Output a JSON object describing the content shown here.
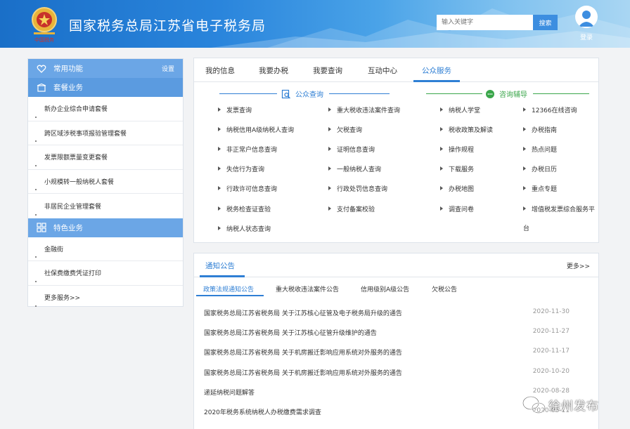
{
  "header": {
    "title": "国家税务总局江苏省电子税务局",
    "emblem_text": "中国税务",
    "search_placeholder": "输入关键字",
    "search_button": "搜索",
    "login_label": "登录"
  },
  "left_panel": {
    "common": {
      "label": "常用功能",
      "settings": "设置"
    },
    "package": {
      "label": "套餐业务",
      "items": [
        "新办企业综合申请套餐",
        "跨区域涉税事项报验管理套餐",
        "发票限额票量变更套餐",
        "小规模转一般纳税人套餐",
        "非居民企业管理套餐"
      ]
    },
    "special": {
      "label": "特色业务",
      "items": [
        "金融街",
        "社保费缴费凭证打印",
        "更多服务>>"
      ]
    }
  },
  "services": {
    "tabs": [
      "我的信息",
      "我要办税",
      "我要查询",
      "互动中心",
      "公众服务"
    ],
    "active_tab": "公众服务",
    "public_query": {
      "title": "公众查询",
      "col1": [
        "发票查询",
        "纳税信用A级纳税人查询",
        "非正常户信息查询",
        "失信行为查询",
        "行政许可信息查询",
        "税务检查证查验",
        "纳税人状态查询"
      ],
      "col2": [
        "重大税收违法案件查询",
        "欠税查询",
        "证明信息查询",
        "一般纳税人查询",
        "行政处罚信息查询",
        "支付备案校验"
      ]
    },
    "consult": {
      "title": "咨询辅导",
      "col1": [
        "纳税人学堂",
        "税收政策及解读",
        "操作规程",
        "下载服务",
        "办税地图",
        "调查问卷"
      ],
      "col2": [
        "12366在线咨询",
        "办税指南",
        "热点问题",
        "办税日历",
        "重点专题",
        "增值税发票综合服务平",
        "台"
      ]
    }
  },
  "notice": {
    "title": "通知公告",
    "more": "更多>>",
    "subtabs": [
      "政策法规通知公告",
      "重大税收违法案件公告",
      "信用级别A级公告",
      "欠税公告"
    ],
    "items": [
      {
        "title": "国家税务总局江苏省税务局 关于江苏核心征管及电子税务局升级的通告",
        "date": "2020-11-30"
      },
      {
        "title": "国家税务总局江苏省税务局 关于江苏核心征管升级维护的通告",
        "date": "2020-11-27"
      },
      {
        "title": "国家税务总局江苏省税务局 关于机房搬迁影响应用系统对外服务的通告",
        "date": "2020-11-17"
      },
      {
        "title": "国家税务总局江苏省税务局 关于机房搬迁影响应用系统对外服务的通告",
        "date": "2020-10-20"
      },
      {
        "title": "递延纳税问题解答",
        "date": "2020-08-28"
      },
      {
        "title": "2020年税务系统纳税人办税缴费需求调查",
        "date": "2020-03-11"
      }
    ]
  },
  "watermark": {
    "text": "徐州发布"
  },
  "colors": {
    "accent": "#2f7fd4",
    "section": "#6ba6e6",
    "consult": "#3aa64a"
  }
}
